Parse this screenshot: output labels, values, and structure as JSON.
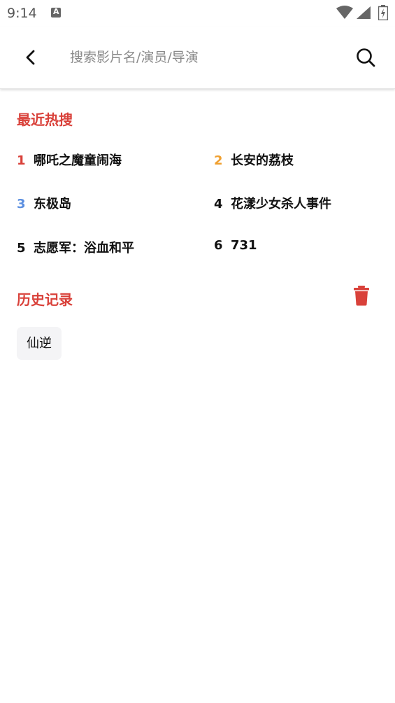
{
  "status_bar": {
    "time": "9:14",
    "notification_letter": "A"
  },
  "search": {
    "placeholder": "搜索影片名/演员/导演",
    "value": ""
  },
  "hot_section": {
    "title": "最近热搜",
    "items": [
      {
        "rank": "1",
        "label": "哪吒之魔童闹海",
        "rank_color": "#d9413a"
      },
      {
        "rank": "2",
        "label": "长安的荔枝",
        "rank_color": "#f0a030"
      },
      {
        "rank": "3",
        "label": "东极岛",
        "rank_color": "#5b8fe0"
      },
      {
        "rank": "4",
        "label": "花漾少女杀人事件",
        "rank_color": "#111111"
      },
      {
        "rank": "5",
        "label": "志愿军：浴血和平",
        "rank_color": "#111111"
      },
      {
        "rank": "6",
        "label": "731",
        "rank_color": "#111111"
      }
    ]
  },
  "history_section": {
    "title": "历史记录",
    "items": [
      "仙逆"
    ]
  },
  "colors": {
    "accent": "#d9413a"
  }
}
